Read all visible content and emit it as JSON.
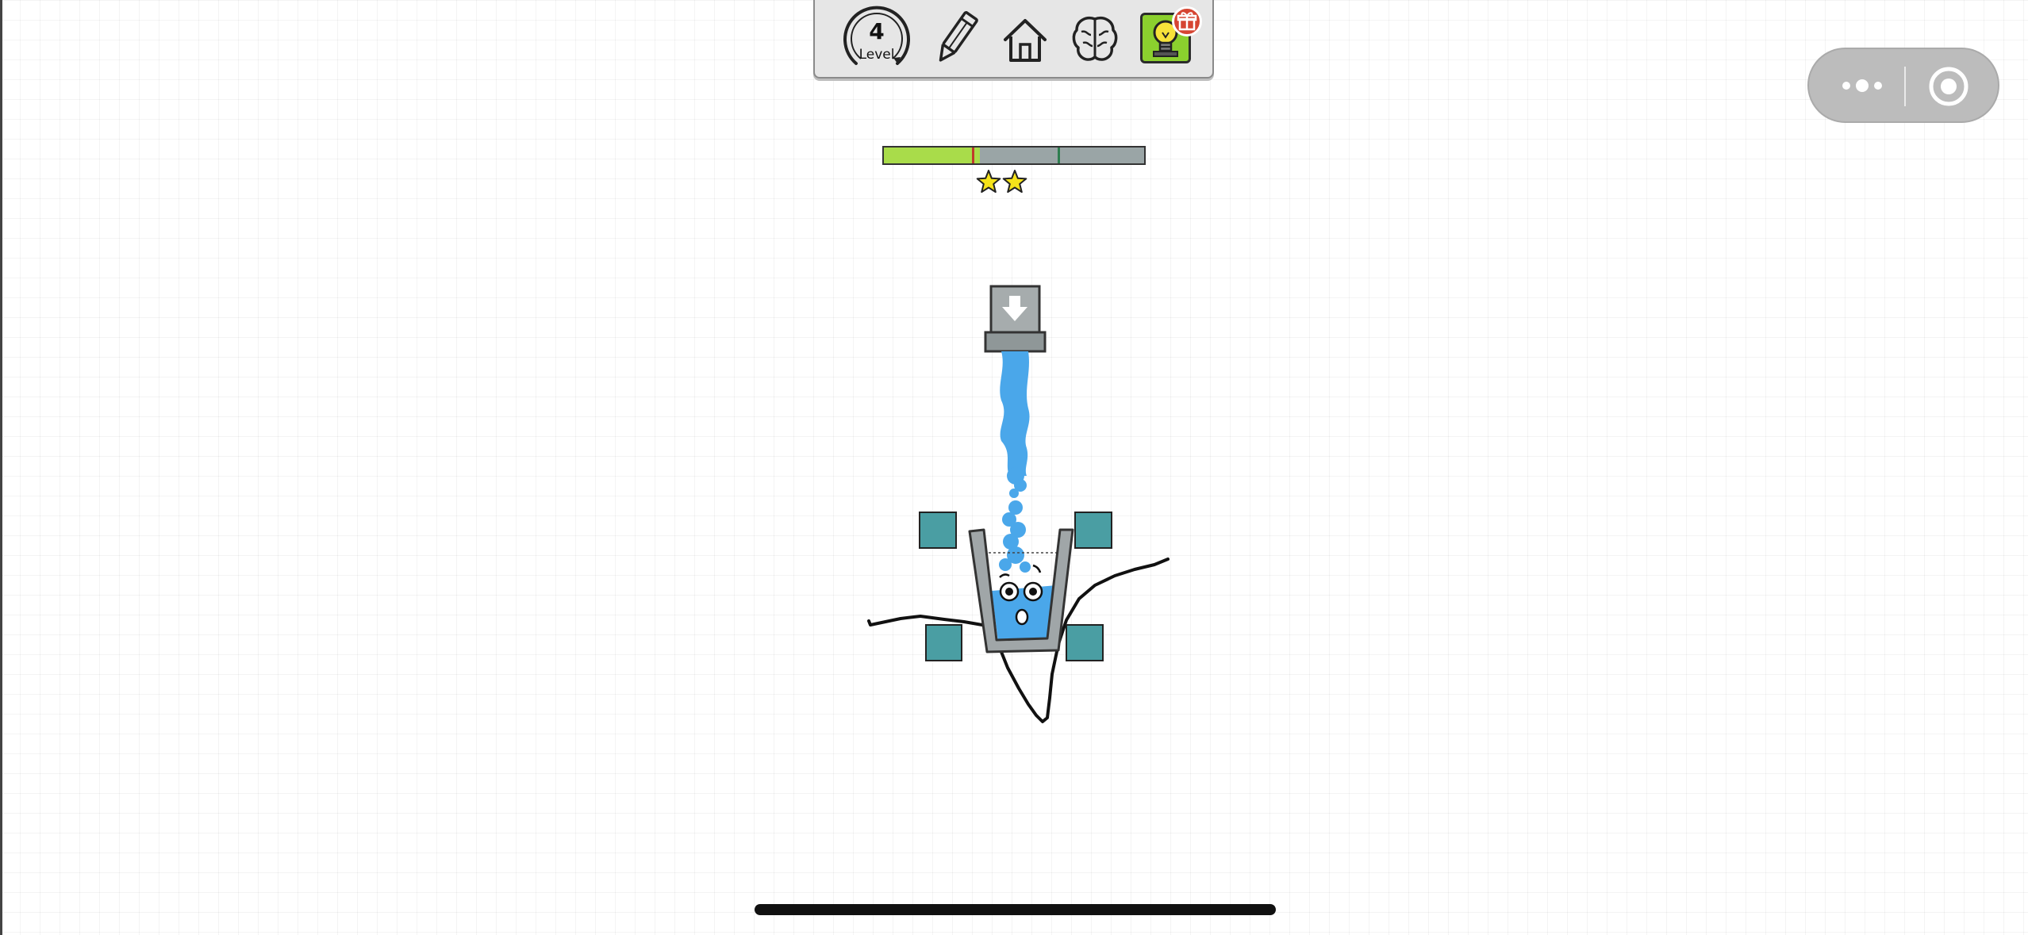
{
  "toolbar": {
    "level_number": "4",
    "level_label": "Level",
    "buttons": [
      {
        "name": "level",
        "icon": "circular-level-gauge-icon"
      },
      {
        "name": "draw",
        "icon": "pencil-icon"
      },
      {
        "name": "home",
        "icon": "home-icon"
      },
      {
        "name": "brain",
        "icon": "brain-icon"
      },
      {
        "name": "hint",
        "icon": "lightbulb-icon",
        "accent": "#8bd02e",
        "badge_icon": "gift-icon",
        "badge_color": "#d64532"
      }
    ]
  },
  "mini_program_capsule": {
    "more_icon": "more-dots-icon",
    "close_icon": "target-circle-icon"
  },
  "ink_meter": {
    "remaining_fraction": 0.37,
    "star_thresholds": [
      0.34,
      0.67
    ],
    "threshold_colors": [
      "#c0392b",
      "#2e7d4f"
    ],
    "fill_color": "#a9dc4a",
    "empty_color": "#9aa5a6",
    "stars_remaining": 2,
    "star_color": "#f5e31a"
  },
  "scene": {
    "water_source_icon": "down-arrow-icon",
    "water_color": "#4aa7ea",
    "block_color": "#4a9ea3",
    "block_count": 4,
    "glass_fill_level": 0.6,
    "character_expression": "surprised"
  }
}
